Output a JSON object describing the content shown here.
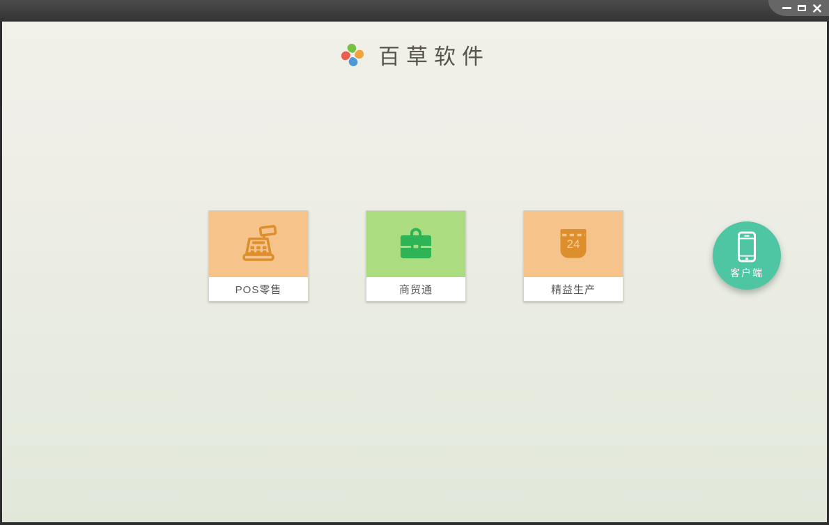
{
  "titlebar": {
    "window_controls": [
      {
        "name": "minimize"
      },
      {
        "name": "maximize"
      },
      {
        "name": "close"
      }
    ]
  },
  "header": {
    "logo": "pinwheel-logo",
    "app_title": "百草软件"
  },
  "product_tiles": [
    {
      "label": "POS零售",
      "icon": "cash-register-icon",
      "tile_color": "#f6c48b",
      "icon_color": "#dd8f2e"
    },
    {
      "label": "商贸通",
      "icon": "briefcase-icon",
      "tile_color": "#abdd80",
      "icon_color": "#2eb356"
    },
    {
      "label": "精益生产",
      "icon": "calendar-icon",
      "tile_color": "#f6c48b",
      "icon_color": "#dd8f2e",
      "calendar_day": "24"
    }
  ],
  "client_button": {
    "label": "客户端",
    "icon": "smartphone-icon",
    "color": "#4ec6a3"
  },
  "colors": {
    "titlebar_top": "#4b4b4b",
    "titlebar_bottom": "#333333",
    "controls_panel": "#666666",
    "window_border": "#2e2e2e",
    "background_top": "#f1f0e9",
    "background_bottom": "#e1e8da",
    "title_text": "#57544b",
    "label_text": "#595959",
    "logo_green": "#76c043",
    "logo_orange": "#f2a33c",
    "logo_blue": "#4f97d6",
    "logo_red": "#e6604d"
  }
}
